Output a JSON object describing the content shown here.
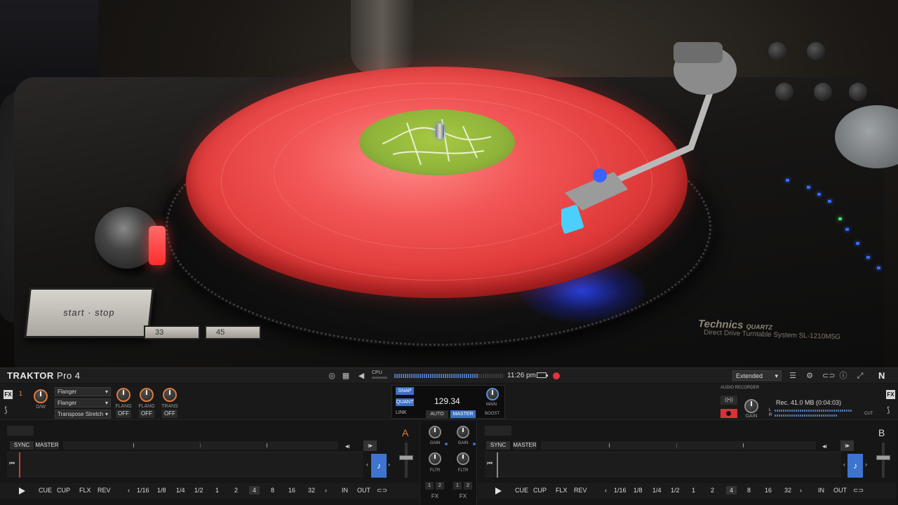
{
  "photo": {
    "start_stop_label": "start · stop",
    "speed_33": "33",
    "speed_45": "45",
    "brand": "Technics",
    "brand_quartz": "QUARTZ",
    "brand_sub": "Direct Drive Turntable System  SL-1210M5G"
  },
  "app": {
    "logo_main": "TRAKTOR",
    "logo_sub": "Pro 4",
    "cpu_label": "CPU",
    "clock": "11:26 pm",
    "layout_select": "Extended",
    "ni_logo": "N"
  },
  "fx_unit_left": {
    "tag": "FX",
    "number": "1",
    "dw_label": "D/W",
    "effects": [
      "Flanger",
      "Flanger",
      "Transpose Stretch"
    ],
    "knobs": [
      "FLANG",
      "FLANG",
      "TRANS"
    ],
    "buttons": [
      "OFF",
      "OFF",
      "OFF"
    ]
  },
  "fx_unit_right": {
    "tag": "FX"
  },
  "master": {
    "snap": "SNAP",
    "quant": "QUANT",
    "tempo": "129.34",
    "link": "LINK",
    "auto": "AUTO",
    "master": "MASTER",
    "main": "MAIN",
    "boost": "BOOST"
  },
  "recorder": {
    "title": "AUDIO  RECORDER",
    "mode_icon": "((•))",
    "gain_label": "GAIN",
    "info": "Rec. 41.0 MB (0:04:03)",
    "l_label": "L",
    "r_label": "R",
    "cut_label": "CUT"
  },
  "deck_a": {
    "letter": "A",
    "sync": "SYNC",
    "master": "MASTER",
    "cue": "CUE",
    "cup": "CUP",
    "flx": "FLX",
    "rev": "REV",
    "loop_sizes": [
      "1/16",
      "1/8",
      "1/4",
      "1/2",
      "1",
      "2",
      "4",
      "8",
      "16",
      "32"
    ],
    "active_loop": "4",
    "in": "IN",
    "out": "OUT",
    "key_icon": "♪"
  },
  "deck_b": {
    "letter": "B",
    "sync": "SYNC",
    "master": "MASTER",
    "cue": "CUE",
    "cup": "CUP",
    "flx": "FLX",
    "rev": "REV",
    "loop_sizes": [
      "1/16",
      "1/8",
      "1/4",
      "1/2",
      "1",
      "2",
      "4",
      "8",
      "16",
      "32"
    ],
    "active_loop": "4",
    "in": "IN",
    "out": "OUT",
    "key_icon": "♪"
  },
  "mixer": {
    "gain": "GAIN",
    "fltr": "FLTR",
    "fx": "FX",
    "assign_1": "1",
    "assign_2": "2"
  },
  "colors": {
    "accent_blue": "#3b70c4",
    "accent_orange": "#e07b3c",
    "record_red": "#d83238"
  }
}
